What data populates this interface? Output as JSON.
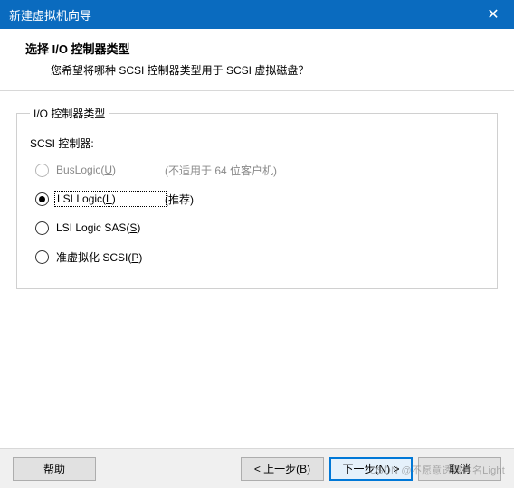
{
  "titlebar": {
    "title": "新建虚拟机向导",
    "close_glyph": "✕"
  },
  "header": {
    "title": "选择 I/O 控制器类型",
    "subtitle": "您希望将哪种 SCSI 控制器类型用于 SCSI 虚拟磁盘？"
  },
  "group": {
    "legend": "I/O 控制器类型",
    "scsi_label": "SCSI 控制器:",
    "options": [
      {
        "label_pre": "BusLogic(",
        "accel": "U",
        "label_post": ")",
        "note": "(不适用于 64 位客户机)",
        "disabled": true,
        "selected": false,
        "focused": false
      },
      {
        "label_pre": "LSI Logic(",
        "accel": "L",
        "label_post": ")",
        "note": "(推荐)",
        "disabled": false,
        "selected": true,
        "focused": true
      },
      {
        "label_pre": "LSI Logic SAS(",
        "accel": "S",
        "label_post": ")",
        "note": "",
        "disabled": false,
        "selected": false,
        "focused": false
      },
      {
        "label_pre": "准虚拟化 SCSI(",
        "accel": "P",
        "label_post": ")",
        "note": "",
        "disabled": false,
        "selected": false,
        "focused": false
      }
    ]
  },
  "footer": {
    "help": "帮助",
    "back_pre": "< 上一步(",
    "back_accel": "B",
    "back_post": ")",
    "next_pre": "下一步(",
    "next_accel": "N",
    "next_post": ") >",
    "cancel": "取消"
  },
  "watermark": "CSDN @不愿意透露姓名Light"
}
